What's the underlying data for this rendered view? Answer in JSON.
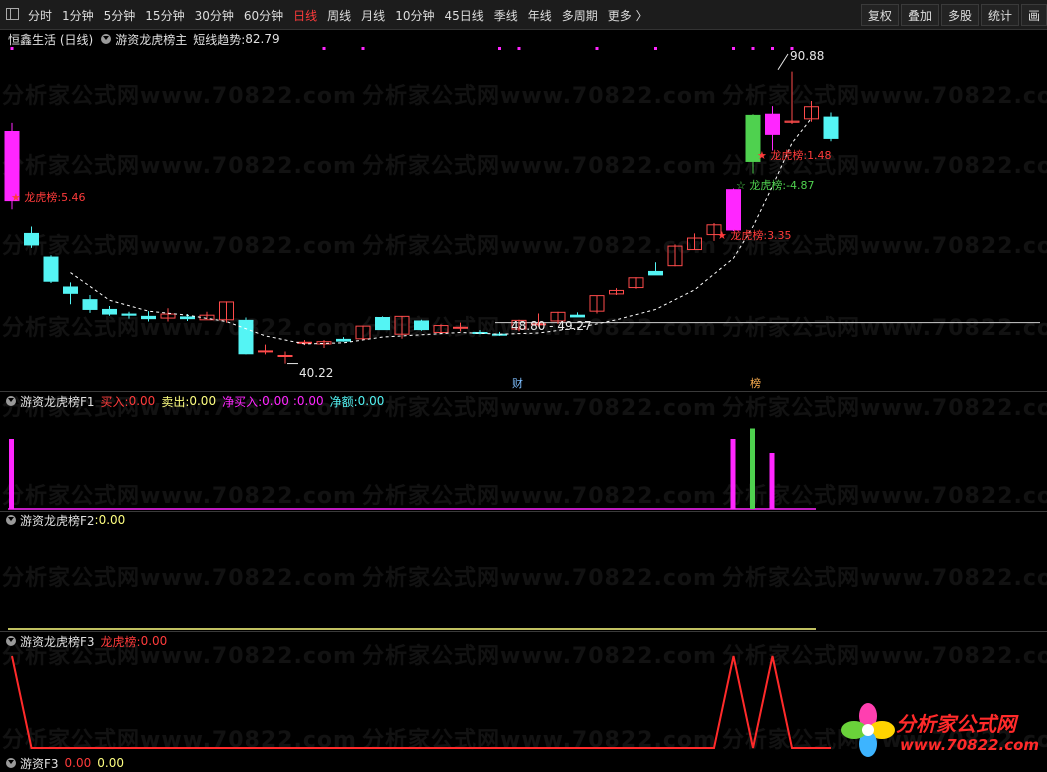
{
  "toolbar": {
    "periods": [
      "分时",
      "1分钟",
      "5分钟",
      "15分钟",
      "30分钟",
      "60分钟",
      "日线",
      "周线",
      "月线",
      "10分钟",
      "45日线",
      "季线",
      "年线",
      "多周期",
      "更多 〉"
    ],
    "active_period": "日线",
    "tools": [
      "复权",
      "叠加",
      "多股",
      "统计",
      "画"
    ]
  },
  "main_panel": {
    "stock_title": "恒鑫生活 (日线)",
    "indicator_name": "游资龙虎榜主",
    "trend_label": "短线趋势: ",
    "trend_value": "82.79",
    "high_label": "90.88",
    "low_label": "40.22",
    "range_label": "48.80 - 49.27",
    "markers": [
      "★ 龙虎榜:5.46",
      "★ 龙虎榜:1.48",
      "☆ 龙虎榜:-4.87",
      "★ 龙虎榜:3.35"
    ],
    "event_tags": [
      "财",
      "榜"
    ]
  },
  "f1_panel": {
    "name": "游资龙虎榜F1",
    "buy_label": "买入: ",
    "buy_value": "0.00",
    "sell_label": "卖出: ",
    "sell_value": "0.00",
    "net_buy_label": "净买入: ",
    "net_buy_value": "0.00",
    "net_sell_value": "0.00",
    "net_amount_label": "净额: ",
    "net_amount_value": "0.00"
  },
  "f2_panel": {
    "name": "游资龙虎榜F2",
    "value_label": ": ",
    "value": "0.00"
  },
  "f3_panel": {
    "name": "游资龙虎榜F3",
    "value_label": "龙虎榜: ",
    "value": "0.00"
  },
  "f4_panel": {
    "name": "游资F3",
    "values": [
      "0.00",
      "0.00"
    ]
  },
  "watermark": "分析家公式网www.70822.com",
  "logo": {
    "title": "分析家公式网",
    "url": "www.70822.com"
  },
  "colors": {
    "up": "#ff4b4b",
    "down": "#54f4f4",
    "magenta": "#ff26ff",
    "green": "#4fd14f",
    "yellow": "#ffff80",
    "red": "#ff2a2a"
  },
  "chart_data": {
    "type": "candlestick",
    "candles": [
      {
        "o": 80.5,
        "h": 82.0,
        "l": 67.0,
        "c": 68.5,
        "color": "magenta"
      },
      {
        "o": 62.8,
        "h": 64.0,
        "l": 60.3,
        "c": 60.8,
        "color": "down"
      },
      {
        "o": 58.7,
        "h": 59.0,
        "l": 54.2,
        "c": 54.5,
        "color": "down"
      },
      {
        "o": 53.5,
        "h": 54.3,
        "l": 50.5,
        "c": 52.4,
        "color": "down"
      },
      {
        "o": 51.3,
        "h": 52.1,
        "l": 49.0,
        "c": 49.6,
        "color": "down"
      },
      {
        "o": 49.6,
        "h": 50.2,
        "l": 48.5,
        "c": 48.8,
        "color": "down"
      },
      {
        "o": 48.8,
        "h": 49.2,
        "l": 48.0,
        "c": 48.6,
        "color": "down"
      },
      {
        "o": 48.4,
        "h": 49.3,
        "l": 47.5,
        "c": 48.0,
        "color": "down"
      },
      {
        "o": 48.1,
        "h": 49.8,
        "l": 47.5,
        "c": 48.8,
        "color": "up"
      },
      {
        "o": 48.3,
        "h": 48.8,
        "l": 47.6,
        "c": 48.0,
        "color": "down"
      },
      {
        "o": 48.6,
        "h": 49.2,
        "l": 47.9,
        "c": 47.8,
        "color": "up"
      },
      {
        "o": 47.8,
        "h": 51.0,
        "l": 47.3,
        "c": 50.9,
        "color": "up"
      },
      {
        "o": 47.7,
        "h": 48.2,
        "l": 41.8,
        "c": 41.9,
        "color": "down"
      },
      {
        "o": 42.4,
        "h": 43.5,
        "l": 41.8,
        "c": 42.4,
        "color": "up"
      },
      {
        "o": 41.5,
        "h": 42.3,
        "l": 40.2,
        "c": 41.6,
        "color": "up"
      },
      {
        "o": 43.9,
        "h": 44.3,
        "l": 43.4,
        "c": 43.9,
        "color": "up"
      },
      {
        "o": 43.6,
        "h": 44.3,
        "l": 42.9,
        "c": 44.0,
        "color": "up"
      },
      {
        "o": 44.4,
        "h": 44.8,
        "l": 44.0,
        "c": 44.1,
        "color": "down"
      },
      {
        "o": 44.5,
        "h": 46.8,
        "l": 44.3,
        "c": 46.7,
        "color": "up"
      },
      {
        "o": 48.2,
        "h": 48.4,
        "l": 46.1,
        "c": 46.1,
        "color": "down"
      },
      {
        "o": 45.3,
        "h": 48.4,
        "l": 44.5,
        "c": 48.4,
        "color": "up"
      },
      {
        "o": 47.6,
        "h": 47.8,
        "l": 45.9,
        "c": 46.1,
        "color": "down"
      },
      {
        "o": 45.6,
        "h": 47.0,
        "l": 45.4,
        "c": 46.8,
        "color": "up"
      },
      {
        "o": 46.5,
        "h": 47.3,
        "l": 45.8,
        "c": 46.5,
        "color": "up"
      },
      {
        "o": 45.6,
        "h": 46.0,
        "l": 45.3,
        "c": 45.6,
        "color": "down"
      },
      {
        "o": 45.3,
        "h": 45.7,
        "l": 45.0,
        "c": 45.2,
        "color": "down"
      },
      {
        "o": 46.2,
        "h": 47.8,
        "l": 45.8,
        "c": 47.7,
        "color": "up"
      },
      {
        "o": 47.1,
        "h": 48.9,
        "l": 46.6,
        "c": 47.1,
        "color": "up"
      },
      {
        "o": 47.6,
        "h": 49.2,
        "l": 47.1,
        "c": 49.1,
        "color": "up"
      },
      {
        "o": 48.6,
        "h": 49.1,
        "l": 48.3,
        "c": 48.3,
        "color": "down"
      },
      {
        "o": 49.3,
        "h": 52.0,
        "l": 48.9,
        "c": 52.0,
        "color": "up"
      },
      {
        "o": 52.3,
        "h": 53.3,
        "l": 52.1,
        "c": 52.9,
        "color": "up"
      },
      {
        "o": 53.4,
        "h": 55.2,
        "l": 53.2,
        "c": 55.1,
        "color": "up"
      },
      {
        "o": 56.2,
        "h": 57.8,
        "l": 55.9,
        "c": 55.6,
        "color": "down"
      },
      {
        "o": 57.2,
        "h": 60.9,
        "l": 57.1,
        "c": 60.6,
        "color": "up"
      },
      {
        "o": 60.0,
        "h": 62.8,
        "l": 60.0,
        "c": 62.0,
        "color": "up"
      },
      {
        "o": 62.6,
        "h": 64.6,
        "l": 61.5,
        "c": 64.3,
        "color": "up"
      },
      {
        "o": 63.4,
        "h": 70.6,
        "l": 63.2,
        "c": 70.4,
        "color": "magenta"
      },
      {
        "o": 75.3,
        "h": 83.5,
        "l": 73.2,
        "c": 83.3,
        "color": "green"
      },
      {
        "o": 80.0,
        "h": 84.9,
        "l": 77.2,
        "c": 83.5,
        "color": "magenta"
      },
      {
        "o": 82.3,
        "h": 90.9,
        "l": 81.8,
        "c": 82.1,
        "color": "up"
      },
      {
        "o": 82.7,
        "h": 85.8,
        "l": 82.2,
        "c": 84.8,
        "color": "up"
      },
      {
        "o": 83.0,
        "h": 83.8,
        "l": 78.8,
        "c": 79.3,
        "color": "down"
      }
    ],
    "trend_line": [
      {
        "i": 3,
        "v": 56.0
      },
      {
        "i": 5,
        "v": 51.2
      },
      {
        "i": 7,
        "v": 49.3
      },
      {
        "i": 9,
        "v": 48.6
      },
      {
        "i": 11,
        "v": 47.5
      },
      {
        "i": 13,
        "v": 45.0
      },
      {
        "i": 15,
        "v": 43.6
      },
      {
        "i": 17,
        "v": 43.8
      },
      {
        "i": 19,
        "v": 44.8
      },
      {
        "i": 21,
        "v": 45.2
      },
      {
        "i": 23,
        "v": 45.6
      },
      {
        "i": 25,
        "v": 45.3
      },
      {
        "i": 27,
        "v": 45.5
      },
      {
        "i": 29,
        "v": 46.4
      },
      {
        "i": 31,
        "v": 47.8
      },
      {
        "i": 33,
        "v": 49.6
      },
      {
        "i": 35,
        "v": 53.0
      },
      {
        "i": 37,
        "v": 58.5
      },
      {
        "i": 38,
        "v": 64.0
      },
      {
        "i": 39,
        "v": 71.0
      },
      {
        "i": 40,
        "v": 78.5
      },
      {
        "i": 41,
        "v": 82.8
      }
    ],
    "ylim": [
      37,
      95
    ],
    "hline": 47.3,
    "f1_bars": [
      {
        "i": 0,
        "v": 1.0,
        "color": "magenta"
      },
      {
        "i": 37,
        "v": 1.0,
        "color": "magenta"
      },
      {
        "i": 38,
        "v": 1.15,
        "color": "green"
      },
      {
        "i": 39,
        "v": 0.8,
        "color": "magenta"
      }
    ],
    "f3_line": [
      {
        "i": 0,
        "v": 1
      },
      {
        "i": 1,
        "v": 0
      },
      {
        "i": 36,
        "v": 0
      },
      {
        "i": 37,
        "v": 1
      },
      {
        "i": 38,
        "v": 0
      },
      {
        "i": 39,
        "v": 1
      },
      {
        "i": 40,
        "v": 0
      },
      {
        "i": 42,
        "v": 0
      }
    ]
  }
}
